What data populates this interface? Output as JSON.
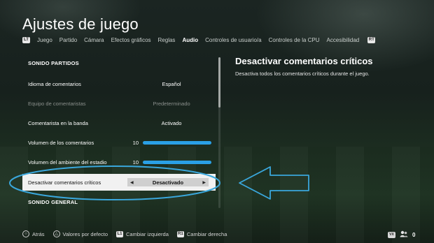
{
  "title": "Ajustes de juego",
  "tabs": {
    "left_hint": "LT",
    "right_hint": "RT",
    "items": [
      "Juego",
      "Partido",
      "Cámara",
      "Efectos gráficos",
      "Reglas",
      "Audio",
      "Controles de usuario/a",
      "Controles de la CPU",
      "Accesibilidad"
    ],
    "active": "Audio"
  },
  "settings": {
    "section_partidos": "SONIDO PARTIDOS",
    "rows": [
      {
        "label": "Idioma de comentarios",
        "value": "Español"
      },
      {
        "label": "Equipo de comentaristas",
        "value": "Predeterminado"
      },
      {
        "label": "Comentarista en la banda",
        "value": "Activado"
      },
      {
        "label": "Volumen de los comentarios",
        "value": "10"
      },
      {
        "label": "Volumen del ambiente del estadio",
        "value": "10"
      }
    ],
    "sliders": [
      {
        "label": "Volumen de los comentarios",
        "level_fraction": 1.0
      },
      {
        "label": "Volumen del ambiente del estadio",
        "level_fraction": 1.0
      }
    ],
    "selected": {
      "label": "Desactivar comentarios críticos",
      "value": "Desactivado"
    },
    "section_general": "SONIDO GENERAL"
  },
  "description": {
    "title": "Desactivar comentarios críticos",
    "text": "Desactiva todos los comentarios críticos durante el juego."
  },
  "footer": {
    "items": [
      {
        "icon": "circle-button-icon",
        "glyph": "○",
        "label": "Atrás"
      },
      {
        "icon": "triangle-button-icon",
        "glyph": "△",
        "label": "Valores por defecto"
      },
      {
        "icon": "l1-button-icon",
        "glyph": "L1",
        "label": "Cambiar izquierda"
      },
      {
        "icon": "r1-button-icon",
        "glyph": "R1",
        "label": "Cambiar derecha"
      }
    ],
    "corner_badge": "VX",
    "friends_count": "0"
  },
  "colors": {
    "accent": "#2aa0e6",
    "annotation": "#3aa7dc",
    "selected_row": "#f1f1f1"
  }
}
